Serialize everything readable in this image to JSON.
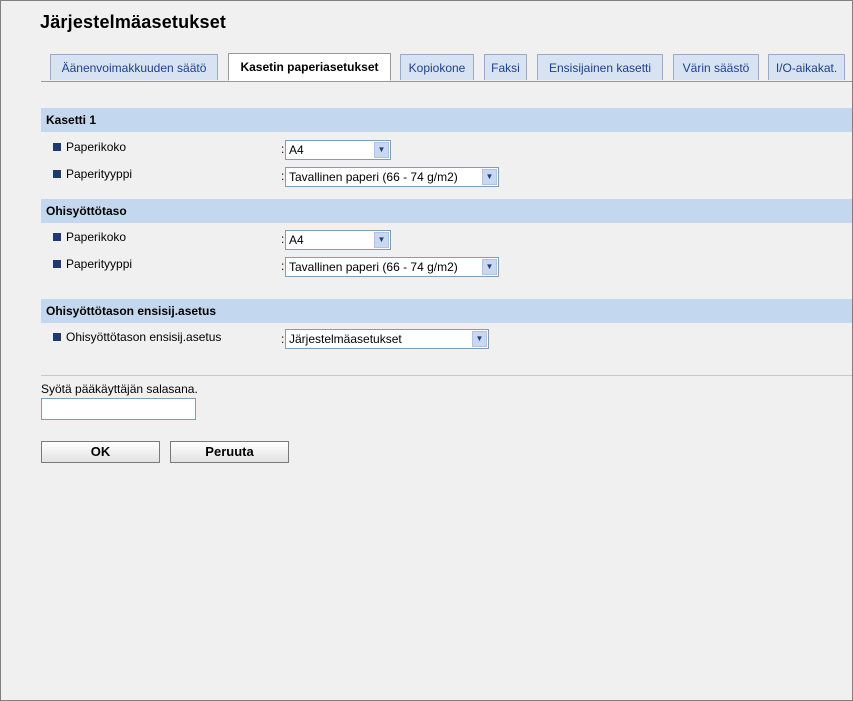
{
  "page": {
    "title": "Järjestelmäasetukset"
  },
  "tabs": [
    {
      "label": "Äänenvoimakkuuden säätö"
    },
    {
      "label": "Kasetin paperiasetukset",
      "active": true
    },
    {
      "label": "Kopiokone"
    },
    {
      "label": "Faksi"
    },
    {
      "label": "Ensisijainen kasetti"
    },
    {
      "label": "Värin säästö"
    },
    {
      "label": "I/O-aikakat."
    }
  ],
  "sections": {
    "tray1": {
      "header": "Kasetti 1",
      "paper_size_label": "Paperikoko",
      "paper_size_value": "A4",
      "paper_type_label": "Paperityyppi",
      "paper_type_value": "Tavallinen paperi (66 - 74 g/m2)"
    },
    "bypass": {
      "header": "Ohisyöttötaso",
      "paper_size_label": "Paperikoko",
      "paper_size_value": "A4",
      "paper_type_label": "Paperityyppi",
      "paper_type_value": "Tavallinen paperi (66 - 74 g/m2)"
    },
    "bypass_priority": {
      "header": "Ohisyöttötason ensisij.asetus",
      "setting_label": "Ohisyöttötason ensisij.asetus",
      "setting_value": "Järjestelmäasetukset"
    }
  },
  "colon": ":",
  "password": {
    "label": "Syötä pääkäyttäjän salasana.",
    "value": ""
  },
  "buttons": {
    "ok": "OK",
    "cancel": "Peruuta"
  },
  "colors": {
    "section_bg": "#c3d8ee",
    "tab_bg": "#d7e3f3",
    "tab_text": "#1f3f8a",
    "bullet": "#1f3a6e"
  }
}
